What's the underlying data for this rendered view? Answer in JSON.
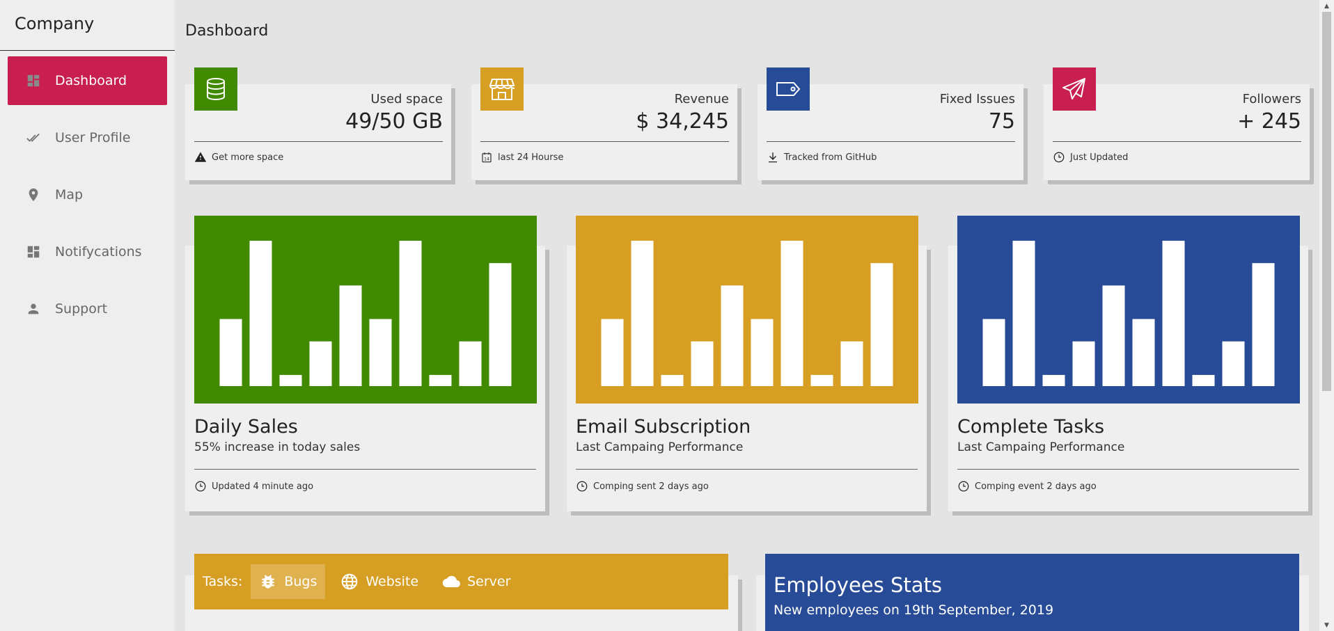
{
  "sidebar": {
    "brand": "Company",
    "items": [
      {
        "label": "Dashboard",
        "icon": "dashboard-icon",
        "active": true
      },
      {
        "label": "User Profile",
        "icon": "double-check-icon"
      },
      {
        "label": "Map",
        "icon": "map-pin-icon"
      },
      {
        "label": "Notifycations",
        "icon": "dashboard-icon"
      },
      {
        "label": "Support",
        "icon": "person-icon"
      }
    ]
  },
  "header": {
    "title": "Dashboard"
  },
  "stats": [
    {
      "label": "Used space",
      "value": "49/50 GB",
      "foot": "Get more space",
      "icon": "database-icon",
      "foot_icon": "warning-icon",
      "color": "#418a00"
    },
    {
      "label": "Revenue",
      "value": "$ 34,245",
      "foot": "last 24 Hourse",
      "icon": "store-icon",
      "foot_icon": "calendar-icon",
      "color": "#d79e24"
    },
    {
      "label": "Fixed Issues",
      "value": "75",
      "foot": "Tracked from GitHub",
      "icon": "tag-icon",
      "foot_icon": "download-icon",
      "color": "#274b97"
    },
    {
      "label": "Followers",
      "value": "+ 245",
      "foot": "Just Updated",
      "icon": "paper-plane-icon",
      "foot_icon": "clock-icon",
      "color": "#c81e50"
    }
  ],
  "charts": [
    {
      "title": "Daily Sales",
      "subtitle": "55% increase in today sales",
      "foot": "Updated 4 minute ago",
      "color": "#418a00"
    },
    {
      "title": "Email Subscription",
      "subtitle": "Last Campaing Performance",
      "foot": "Comping sent 2 days ago",
      "color": "#d79e24"
    },
    {
      "title": "Complete Tasks",
      "subtitle": "Last Campaing Performance",
      "foot": "Comping event 2 days ago",
      "color": "#274b97"
    }
  ],
  "chart_data": [
    {
      "type": "bar",
      "values": [
        6,
        13,
        1,
        4,
        9,
        6,
        13,
        1,
        4,
        11
      ],
      "ylim": [
        0,
        14
      ],
      "grid": false
    },
    {
      "type": "bar",
      "values": [
        6,
        13,
        1,
        4,
        9,
        6,
        13,
        1,
        4,
        11
      ],
      "ylim": [
        0,
        14
      ],
      "grid": false
    },
    {
      "type": "bar",
      "values": [
        6,
        13,
        1,
        4,
        9,
        6,
        13,
        1,
        4,
        11
      ],
      "ylim": [
        0,
        14
      ],
      "grid": false
    }
  ],
  "tasks": {
    "label": "Tasks:",
    "tabs": [
      {
        "label": "Bugs",
        "icon": "bug-icon",
        "active": true
      },
      {
        "label": "Website",
        "icon": "globe-icon"
      },
      {
        "label": "Server",
        "icon": "cloud-icon"
      }
    ]
  },
  "employees": {
    "title": "Employees Stats",
    "subtitle": "New employees on 19th September, 2019"
  }
}
